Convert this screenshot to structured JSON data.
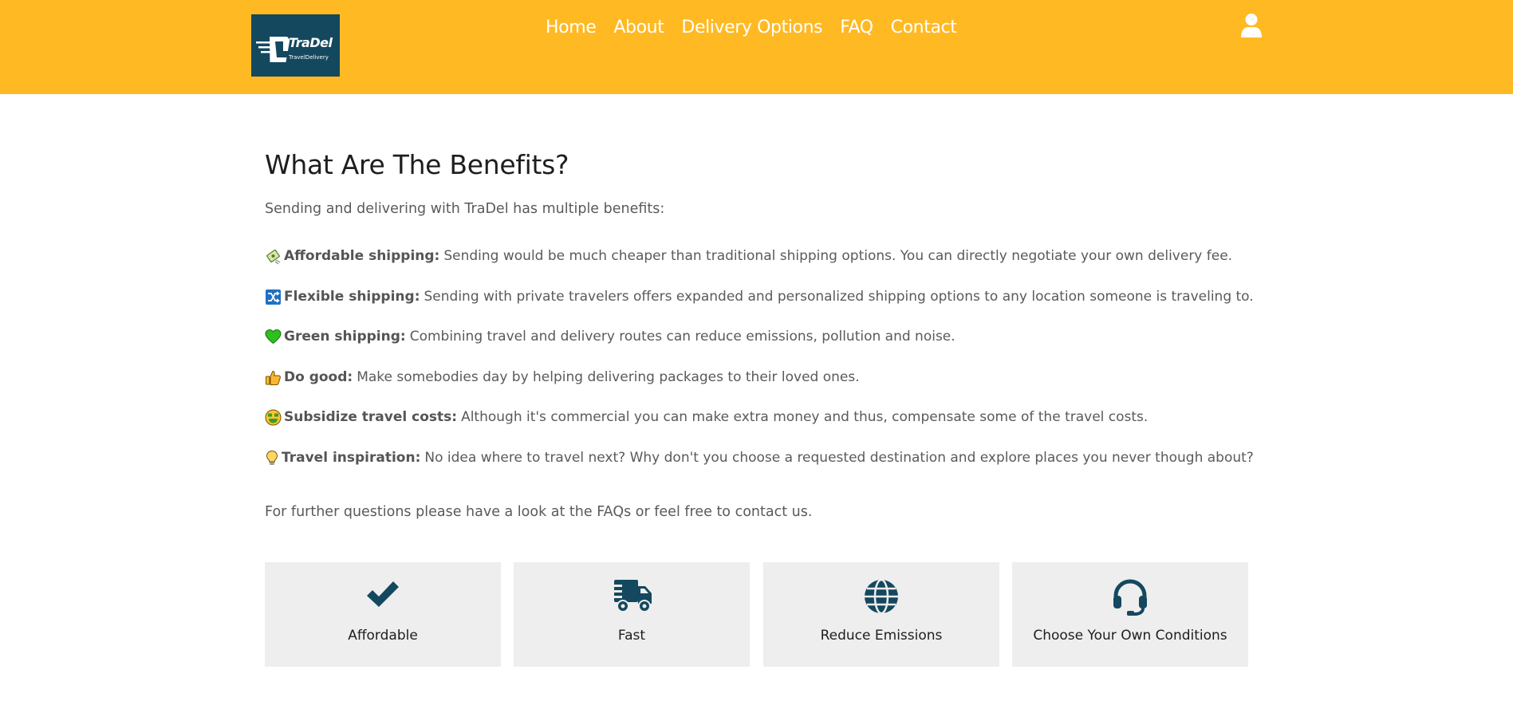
{
  "header": {
    "logo": {
      "brand": "TraDel",
      "tagline": "TravelDelivery"
    },
    "nav": [
      "Home",
      "About",
      "Delivery Options",
      "FAQ",
      "Contact"
    ],
    "user_icon": "user-icon",
    "background": "#FFB923"
  },
  "main": {
    "title": "What Are The Benefits?",
    "intro": "Sending and delivering with TraDel has multiple benefits:",
    "benefits": [
      {
        "icon": "money-with-wings-icon",
        "label": "Affordable shipping:",
        "text": "Sending would be much cheaper than traditional shipping options. You can directly negotiate your own delivery fee."
      },
      {
        "icon": "shuffle-icon",
        "label": "Flexible shipping:",
        "text": "Sending with private travelers offers expanded and personalized shipping options to any location someone is traveling to."
      },
      {
        "icon": "green-heart-icon",
        "label": "Green shipping:",
        "text": "Combining travel and delivery routes can reduce emissions, pollution and noise."
      },
      {
        "icon": "thumbs-up-icon",
        "label": "Do good:",
        "text": "Make somebodies day by helping delivering packages to their loved ones."
      },
      {
        "icon": "money-mouth-face-icon",
        "label": "Subsidize travel costs:",
        "text": "Although it's commercial you can make extra money and thus, compensate some of the travel costs."
      },
      {
        "icon": "light-bulb-icon",
        "label": "Travel inspiration:",
        "text": "No idea where to travel next? Why don't you choose a requested destination and explore places you never though about?"
      }
    ],
    "outro": "For further questions please have a look at the FAQs or feel free to contact us."
  },
  "features": [
    {
      "icon": "checkmark-icon",
      "label": "Affordable"
    },
    {
      "icon": "shipping-fast-icon",
      "label": "Fast"
    },
    {
      "icon": "globe-icon",
      "label": "Reduce Emissions"
    },
    {
      "icon": "headset-icon",
      "label": "Choose Your Own Conditions"
    }
  ],
  "colors": {
    "accent": "#FFB923",
    "brand_dark": "#14485F",
    "card_bg": "#EEEEEE"
  }
}
